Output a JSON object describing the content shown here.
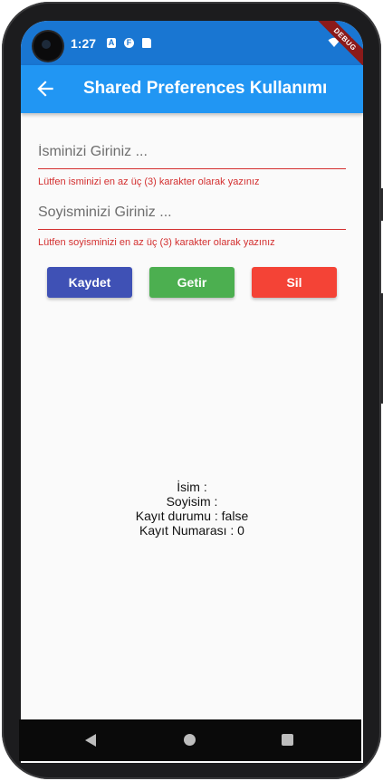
{
  "status_bar": {
    "time": "1:27",
    "icons_left": [
      "a-notification-icon",
      "f-notification-icon",
      "sd-card-icon"
    ],
    "icons_right": [
      "wifi-icon",
      "battery-icon"
    ],
    "debug_banner": "DEBUG"
  },
  "app_bar": {
    "title": "Shared Preferences Kullanımı",
    "back_icon": "arrow-left-icon"
  },
  "form": {
    "name_placeholder": "İsminizi Giriniz ...",
    "name_error": "Lütfen isminizi en az üç (3) karakter olarak yazınız",
    "surname_placeholder": "Soyisminizi Giriniz ...",
    "surname_error": "Lütfen soyisminizi en az üç (3) karakter olarak yazınız"
  },
  "buttons": {
    "save_label": "Kaydet",
    "get_label": "Getir",
    "delete_label": "Sil"
  },
  "info": {
    "name_line": "İsim :",
    "surname_line": "Soyisim :",
    "status_line": "Kayıt durumu : false",
    "number_line": "Kayıt Numarası : 0"
  },
  "colors": {
    "status_bar": "#1976d2",
    "app_bar": "#2196f3",
    "error": "#d32f2f",
    "save": "#3f51b5",
    "get": "#4caf50",
    "delete": "#f44336"
  }
}
